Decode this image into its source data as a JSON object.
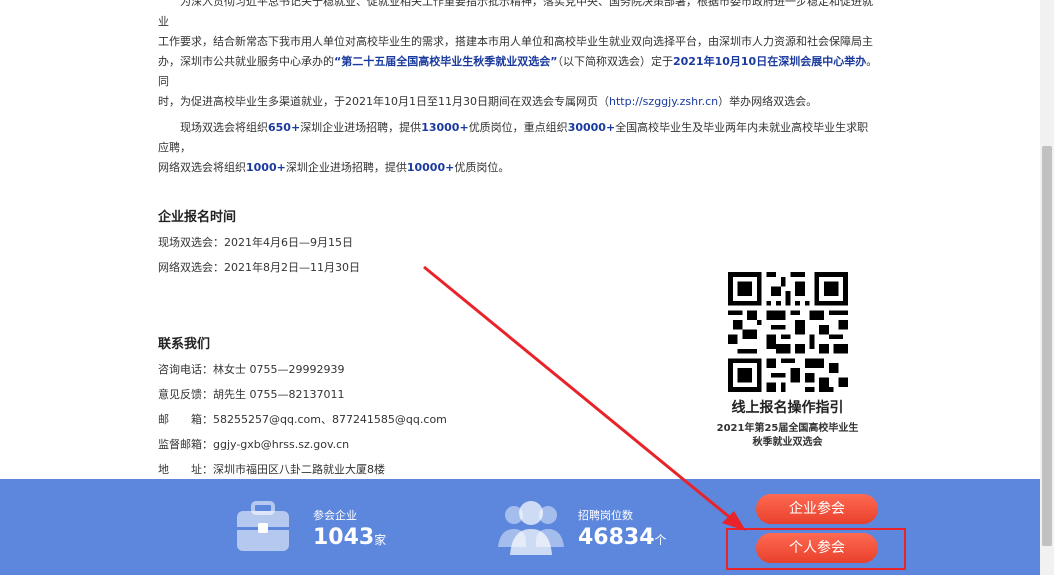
{
  "intro": {
    "line1": "为深入贯彻习近平总书记关于稳就业、促就业相关工作重要指示批示精神，落实党中央、国务院决策部署，根据市委市政府进一步稳定和促进就业",
    "line2": "工作要求，结合新常态下我市用人单位对高校毕业生的需求，搭建本市用人单位和高校毕业生就业双向选择平台，由深圳市人力资源和社会保障局主",
    "line3_a": "办，深圳市公共就业服务中心承办的",
    "line3_hl1": "“第二十五届全国高校毕业生秋季就业双选会”",
    "line3_b": "（以下简称双选会）定于",
    "line3_hl2": "2021年10月10日在深圳会展中心举办",
    "line3_c": "。同",
    "line4_a": "时，为促进高校毕业生多渠道就业，于2021年10月1日至11月30日期间在双选会专属网页（",
    "line4_link": "http://szggjy.zshr.cn",
    "line4_b": "）举办网络双选会。"
  },
  "scale": {
    "l1_a": "现场双选会将组织",
    "l1_n1": "650+",
    "l1_b": "深圳企业进场招聘，提供",
    "l1_n2": "13000+",
    "l1_c": "优质岗位，重点组织",
    "l1_n3": "30000+",
    "l1_d": "全国高校毕业生及毕业两年内未就业高校毕业生求职应聘，",
    "l2_a": "网络双选会将组织",
    "l2_n1": "1000+",
    "l2_b": "深圳企业进场招聘，提供",
    "l2_n2": "10000+",
    "l2_c": "优质岗位。"
  },
  "registration": {
    "title": "企业报名时间",
    "onsite": "现场双选会：2021年4月6日—9月15日",
    "online": "网络双选会：2021年8月2日—11月30日"
  },
  "contact": {
    "title": "联系我们",
    "phone": "咨询电话：林女士 0755—29992939",
    "feedback": "意见反馈：胡先生 0755—82137011",
    "email": "邮　　箱：58255257@qq.com、877241585@qq.com",
    "supervise": "监督邮箱：ggjy-gxb@hrss.sz.gov.cn",
    "address": "地　　址：深圳市福田区八卦二路就业大厦8楼"
  },
  "qr": {
    "title": "线上报名操作指引",
    "sub1": "2021年第25届全国高校毕业生",
    "sub2": "秋季就业双选会"
  },
  "footer": {
    "companies_label": "参会企业",
    "companies_value": "1043",
    "companies_unit": "家",
    "jobs_label": "招聘岗位数",
    "jobs_value": "46834",
    "jobs_unit": "个",
    "company_btn": "企业参会",
    "person_btn": "个人参会"
  },
  "colors": {
    "footer_bg": "#5c87dc",
    "button": "#e8402c",
    "highlight": "#1a3a9e",
    "annotation": "#e8242a"
  },
  "icons": {
    "companies": "briefcase-icon",
    "jobs": "people-icon"
  }
}
